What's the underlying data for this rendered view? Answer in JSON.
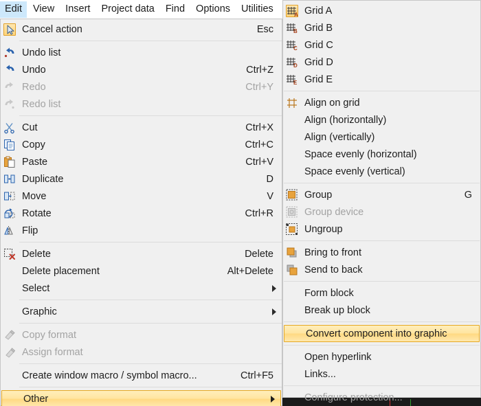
{
  "menubar": {
    "items": [
      {
        "label": "Edit",
        "active": true
      },
      {
        "label": "View",
        "active": false
      },
      {
        "label": "Insert",
        "active": false
      },
      {
        "label": "Project data",
        "active": false
      },
      {
        "label": "Find",
        "active": false
      },
      {
        "label": "Options",
        "active": false
      },
      {
        "label": "Utilities",
        "active": false
      }
    ]
  },
  "edit_menu": {
    "name": "Edit",
    "items": [
      {
        "label": "Cancel action",
        "accel": "Esc",
        "icon": "cursor-arrow-icon",
        "icon_highlight": true
      },
      {
        "sep": true
      },
      {
        "label": "Undo list",
        "accel": "",
        "icon": "undo-list-icon"
      },
      {
        "label": "Undo",
        "accel": "Ctrl+Z",
        "icon": "undo-icon"
      },
      {
        "label": "Redo",
        "accel": "Ctrl+Y",
        "icon": "redo-icon",
        "disabled": true
      },
      {
        "label": "Redo list",
        "accel": "",
        "icon": "redo-list-icon",
        "disabled": true
      },
      {
        "sep": true
      },
      {
        "label": "Cut",
        "accel": "Ctrl+X",
        "icon": "scissors-icon"
      },
      {
        "label": "Copy",
        "accel": "Ctrl+C",
        "icon": "copy-icon"
      },
      {
        "label": "Paste",
        "accel": "Ctrl+V",
        "icon": "paste-icon"
      },
      {
        "label": "Duplicate",
        "accel": "D",
        "icon": "duplicate-icon"
      },
      {
        "label": "Move",
        "accel": "V",
        "icon": "move-icon"
      },
      {
        "label": "Rotate",
        "accel": "Ctrl+R",
        "icon": "rotate-icon"
      },
      {
        "label": "Flip",
        "accel": "",
        "icon": "flip-icon"
      },
      {
        "sep": true
      },
      {
        "label": "Delete",
        "accel": "Delete",
        "icon": "delete-icon"
      },
      {
        "label": "Delete placement",
        "accel": "Alt+Delete",
        "icon": ""
      },
      {
        "label": "Select",
        "accel": "",
        "icon": "",
        "submenu": true
      },
      {
        "sep": true
      },
      {
        "label": "Graphic",
        "accel": "",
        "icon": "",
        "submenu": true
      },
      {
        "sep": true
      },
      {
        "label": "Copy format",
        "accel": "",
        "icon": "copy-format-brush-icon",
        "disabled": true
      },
      {
        "label": "Assign format",
        "accel": "",
        "icon": "assign-format-brush-icon",
        "disabled": true
      },
      {
        "sep": true
      },
      {
        "label": "Create window macro / symbol macro...",
        "accel": "Ctrl+F5",
        "icon": ""
      },
      {
        "sep": true
      },
      {
        "label": "Other",
        "accel": "",
        "icon": "",
        "submenu": true,
        "highlighted": true
      },
      {
        "sep": true
      }
    ]
  },
  "other_submenu": {
    "name": "Other",
    "items": [
      {
        "label": "Grid A",
        "accel": "",
        "icon": "grid-a-icon",
        "icon_highlight": true
      },
      {
        "label": "Grid B",
        "accel": "",
        "icon": "grid-b-icon"
      },
      {
        "label": "Grid C",
        "accel": "",
        "icon": "grid-c-icon"
      },
      {
        "label": "Grid D",
        "accel": "",
        "icon": "grid-d-icon"
      },
      {
        "label": "Grid E",
        "accel": "",
        "icon": "grid-e-icon"
      },
      {
        "sep": true
      },
      {
        "label": "Align on grid",
        "accel": "",
        "icon": "align-on-grid-icon"
      },
      {
        "label": "Align (horizontally)",
        "accel": "",
        "icon": ""
      },
      {
        "label": "Align (vertically)",
        "accel": "",
        "icon": ""
      },
      {
        "label": "Space evenly (horizontal)",
        "accel": "",
        "icon": ""
      },
      {
        "label": "Space evenly (vertical)",
        "accel": "",
        "icon": ""
      },
      {
        "sep": true
      },
      {
        "label": "Group",
        "accel": "G",
        "icon": "group-icon"
      },
      {
        "label": "Group device",
        "accel": "",
        "icon": "group-device-icon",
        "disabled": true
      },
      {
        "label": "Ungroup",
        "accel": "",
        "icon": "ungroup-icon"
      },
      {
        "sep": true
      },
      {
        "label": "Bring to front",
        "accel": "",
        "icon": "bring-to-front-icon"
      },
      {
        "label": "Send to back",
        "accel": "",
        "icon": "send-to-back-icon"
      },
      {
        "sep": true
      },
      {
        "label": "Form block",
        "accel": "",
        "icon": ""
      },
      {
        "label": "Break up block",
        "accel": "",
        "icon": ""
      },
      {
        "sep": true
      },
      {
        "label": "Convert component into graphic",
        "accel": "",
        "icon": "",
        "highlighted": true
      },
      {
        "sep": true
      },
      {
        "label": "Open hyperlink",
        "accel": "",
        "icon": ""
      },
      {
        "label": "Links...",
        "accel": "",
        "icon": ""
      },
      {
        "sep": true
      },
      {
        "label": "Configure protection...",
        "accel": "",
        "icon": "",
        "disabled": true
      }
    ]
  },
  "colors": {
    "menu_background": "#f0f0f0",
    "menu_border": "#c6c6c6",
    "highlight_fill": "#ffe5a0",
    "highlight_border": "#e5a823",
    "menubar_active": "#cde8fb",
    "text": "#1d1d1d",
    "text_disabled": "#a3a3a3",
    "separator": "#dcdcdc",
    "icon_orange": "#e8a33d",
    "icon_blue": "#2a62ad"
  }
}
